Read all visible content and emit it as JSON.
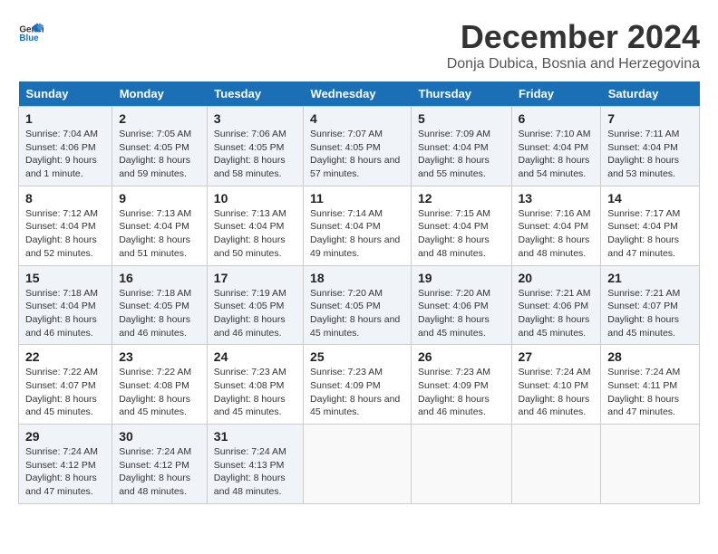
{
  "logo": {
    "general": "General",
    "blue": "Blue"
  },
  "title": "December 2024",
  "subtitle": "Donja Dubica, Bosnia and Herzegovina",
  "days_header": [
    "Sunday",
    "Monday",
    "Tuesday",
    "Wednesday",
    "Thursday",
    "Friday",
    "Saturday"
  ],
  "weeks": [
    [
      {
        "day": "1",
        "sunrise": "Sunrise: 7:04 AM",
        "sunset": "Sunset: 4:06 PM",
        "daylight": "Daylight: 9 hours and 1 minute."
      },
      {
        "day": "2",
        "sunrise": "Sunrise: 7:05 AM",
        "sunset": "Sunset: 4:05 PM",
        "daylight": "Daylight: 8 hours and 59 minutes."
      },
      {
        "day": "3",
        "sunrise": "Sunrise: 7:06 AM",
        "sunset": "Sunset: 4:05 PM",
        "daylight": "Daylight: 8 hours and 58 minutes."
      },
      {
        "day": "4",
        "sunrise": "Sunrise: 7:07 AM",
        "sunset": "Sunset: 4:05 PM",
        "daylight": "Daylight: 8 hours and 57 minutes."
      },
      {
        "day": "5",
        "sunrise": "Sunrise: 7:09 AM",
        "sunset": "Sunset: 4:04 PM",
        "daylight": "Daylight: 8 hours and 55 minutes."
      },
      {
        "day": "6",
        "sunrise": "Sunrise: 7:10 AM",
        "sunset": "Sunset: 4:04 PM",
        "daylight": "Daylight: 8 hours and 54 minutes."
      },
      {
        "day": "7",
        "sunrise": "Sunrise: 7:11 AM",
        "sunset": "Sunset: 4:04 PM",
        "daylight": "Daylight: 8 hours and 53 minutes."
      }
    ],
    [
      {
        "day": "8",
        "sunrise": "Sunrise: 7:12 AM",
        "sunset": "Sunset: 4:04 PM",
        "daylight": "Daylight: 8 hours and 52 minutes."
      },
      {
        "day": "9",
        "sunrise": "Sunrise: 7:13 AM",
        "sunset": "Sunset: 4:04 PM",
        "daylight": "Daylight: 8 hours and 51 minutes."
      },
      {
        "day": "10",
        "sunrise": "Sunrise: 7:13 AM",
        "sunset": "Sunset: 4:04 PM",
        "daylight": "Daylight: 8 hours and 50 minutes."
      },
      {
        "day": "11",
        "sunrise": "Sunrise: 7:14 AM",
        "sunset": "Sunset: 4:04 PM",
        "daylight": "Daylight: 8 hours and 49 minutes."
      },
      {
        "day": "12",
        "sunrise": "Sunrise: 7:15 AM",
        "sunset": "Sunset: 4:04 PM",
        "daylight": "Daylight: 8 hours and 48 minutes."
      },
      {
        "day": "13",
        "sunrise": "Sunrise: 7:16 AM",
        "sunset": "Sunset: 4:04 PM",
        "daylight": "Daylight: 8 hours and 48 minutes."
      },
      {
        "day": "14",
        "sunrise": "Sunrise: 7:17 AM",
        "sunset": "Sunset: 4:04 PM",
        "daylight": "Daylight: 8 hours and 47 minutes."
      }
    ],
    [
      {
        "day": "15",
        "sunrise": "Sunrise: 7:18 AM",
        "sunset": "Sunset: 4:04 PM",
        "daylight": "Daylight: 8 hours and 46 minutes."
      },
      {
        "day": "16",
        "sunrise": "Sunrise: 7:18 AM",
        "sunset": "Sunset: 4:05 PM",
        "daylight": "Daylight: 8 hours and 46 minutes."
      },
      {
        "day": "17",
        "sunrise": "Sunrise: 7:19 AM",
        "sunset": "Sunset: 4:05 PM",
        "daylight": "Daylight: 8 hours and 46 minutes."
      },
      {
        "day": "18",
        "sunrise": "Sunrise: 7:20 AM",
        "sunset": "Sunset: 4:05 PM",
        "daylight": "Daylight: 8 hours and 45 minutes."
      },
      {
        "day": "19",
        "sunrise": "Sunrise: 7:20 AM",
        "sunset": "Sunset: 4:06 PM",
        "daylight": "Daylight: 8 hours and 45 minutes."
      },
      {
        "day": "20",
        "sunrise": "Sunrise: 7:21 AM",
        "sunset": "Sunset: 4:06 PM",
        "daylight": "Daylight: 8 hours and 45 minutes."
      },
      {
        "day": "21",
        "sunrise": "Sunrise: 7:21 AM",
        "sunset": "Sunset: 4:07 PM",
        "daylight": "Daylight: 8 hours and 45 minutes."
      }
    ],
    [
      {
        "day": "22",
        "sunrise": "Sunrise: 7:22 AM",
        "sunset": "Sunset: 4:07 PM",
        "daylight": "Daylight: 8 hours and 45 minutes."
      },
      {
        "day": "23",
        "sunrise": "Sunrise: 7:22 AM",
        "sunset": "Sunset: 4:08 PM",
        "daylight": "Daylight: 8 hours and 45 minutes."
      },
      {
        "day": "24",
        "sunrise": "Sunrise: 7:23 AM",
        "sunset": "Sunset: 4:08 PM",
        "daylight": "Daylight: 8 hours and 45 minutes."
      },
      {
        "day": "25",
        "sunrise": "Sunrise: 7:23 AM",
        "sunset": "Sunset: 4:09 PM",
        "daylight": "Daylight: 8 hours and 45 minutes."
      },
      {
        "day": "26",
        "sunrise": "Sunrise: 7:23 AM",
        "sunset": "Sunset: 4:09 PM",
        "daylight": "Daylight: 8 hours and 46 minutes."
      },
      {
        "day": "27",
        "sunrise": "Sunrise: 7:24 AM",
        "sunset": "Sunset: 4:10 PM",
        "daylight": "Daylight: 8 hours and 46 minutes."
      },
      {
        "day": "28",
        "sunrise": "Sunrise: 7:24 AM",
        "sunset": "Sunset: 4:11 PM",
        "daylight": "Daylight: 8 hours and 47 minutes."
      }
    ],
    [
      {
        "day": "29",
        "sunrise": "Sunrise: 7:24 AM",
        "sunset": "Sunset: 4:12 PM",
        "daylight": "Daylight: 8 hours and 47 minutes."
      },
      {
        "day": "30",
        "sunrise": "Sunrise: 7:24 AM",
        "sunset": "Sunset: 4:12 PM",
        "daylight": "Daylight: 8 hours and 48 minutes."
      },
      {
        "day": "31",
        "sunrise": "Sunrise: 7:24 AM",
        "sunset": "Sunset: 4:13 PM",
        "daylight": "Daylight: 8 hours and 48 minutes."
      },
      null,
      null,
      null,
      null
    ]
  ]
}
